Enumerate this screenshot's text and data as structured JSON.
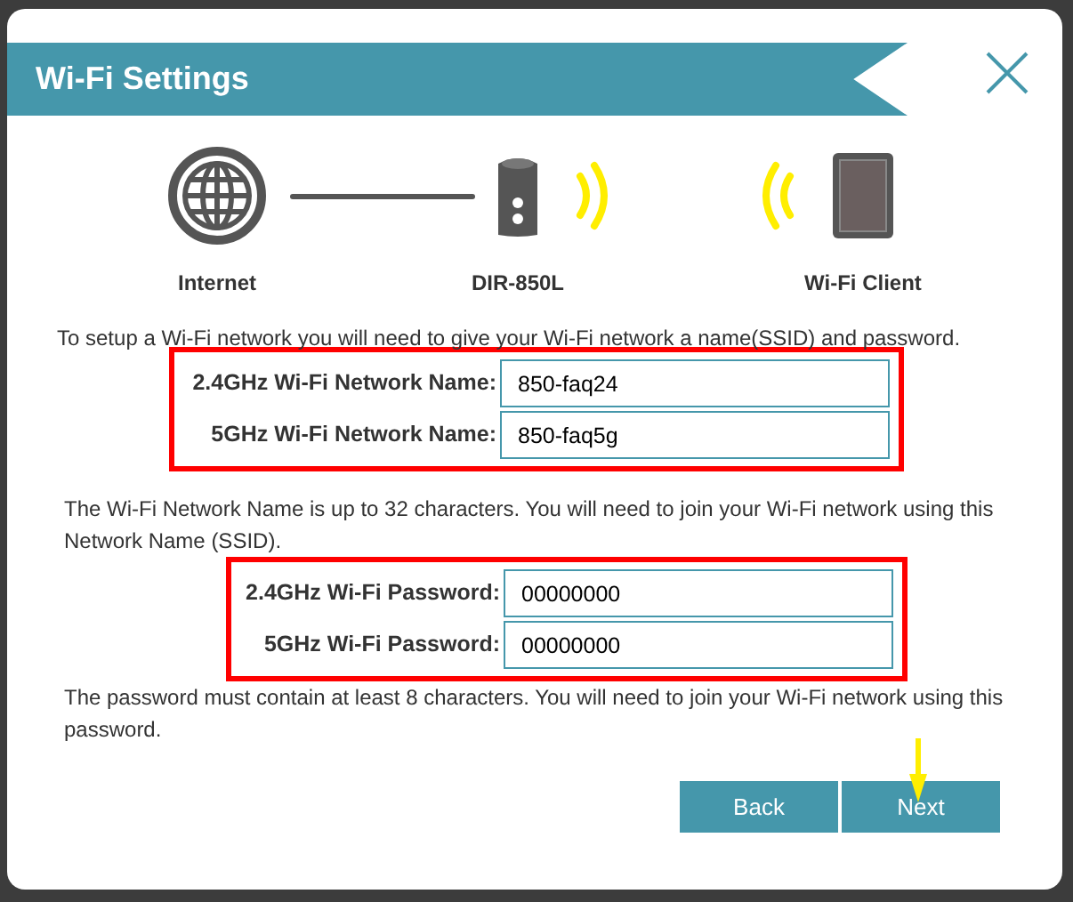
{
  "dialog": {
    "title": "Wi-Fi Settings"
  },
  "diagram": [
    {
      "kind": "globe",
      "label": "Internet"
    },
    {
      "kind": "router",
      "label": "DIR-850L"
    },
    {
      "kind": "client",
      "label": "Wi-Fi Client"
    }
  ],
  "intro": "To setup a Wi-Fi network you will need to give your Wi-Fi network a name(SSID) and password.",
  "groups": [
    {
      "highlighted": true,
      "fields": [
        {
          "label": "2.4GHz Wi-Fi Network Name:",
          "value": "850-faq24"
        },
        {
          "label": "5GHz Wi-Fi Network Name:",
          "value": "850-faq5g"
        }
      ],
      "note": "The Wi-Fi Network Name is up to 32 characters. You will need to join your Wi-Fi network using this Network Name (SSID)."
    },
    {
      "highlighted": true,
      "fields": [
        {
          "label": "2.4GHz Wi-Fi Password:",
          "value": "00000000"
        },
        {
          "label": "5GHz Wi-Fi Password:",
          "value": "00000000"
        }
      ],
      "note": "The password must contain at least 8 characters. You will need to join your Wi-Fi network using this password."
    }
  ],
  "buttons": [
    {
      "label": "Back",
      "pointed": false
    },
    {
      "label": "Next",
      "pointed": true
    }
  ]
}
